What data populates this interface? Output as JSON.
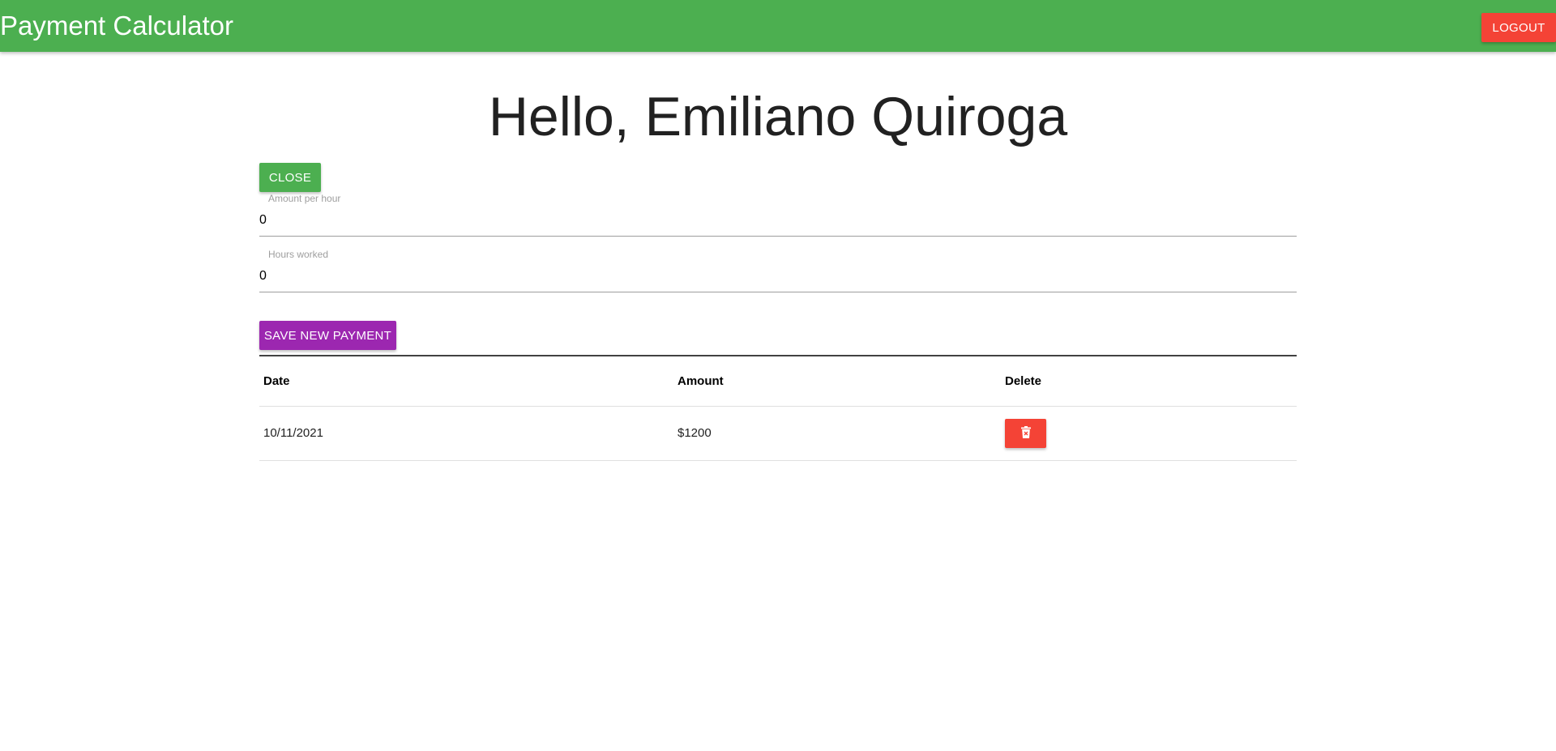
{
  "app": {
    "title": "Payment Calculator"
  },
  "navbar": {
    "logout_label": "LOGOUT"
  },
  "greeting": "Hello, Emiliano Quiroga",
  "form": {
    "close_label": "CLOSE",
    "amount_per_hour": {
      "label": "Amount per hour",
      "value": "0"
    },
    "hours_worked": {
      "label": "Hours worked",
      "value": "0"
    },
    "save_label": "SAVE NEW PAYMENT"
  },
  "table": {
    "headers": {
      "date": "Date",
      "amount": "Amount",
      "delete": "Delete"
    },
    "rows": [
      {
        "date": "10/11/2021",
        "amount": "$1200",
        "action_icon": "trash-icon"
      }
    ]
  },
  "colors": {
    "navbar": "#4caf50",
    "logout": "#f44336",
    "close": "#4caf50",
    "save": "#9c27b0",
    "delete": "#f44336"
  }
}
